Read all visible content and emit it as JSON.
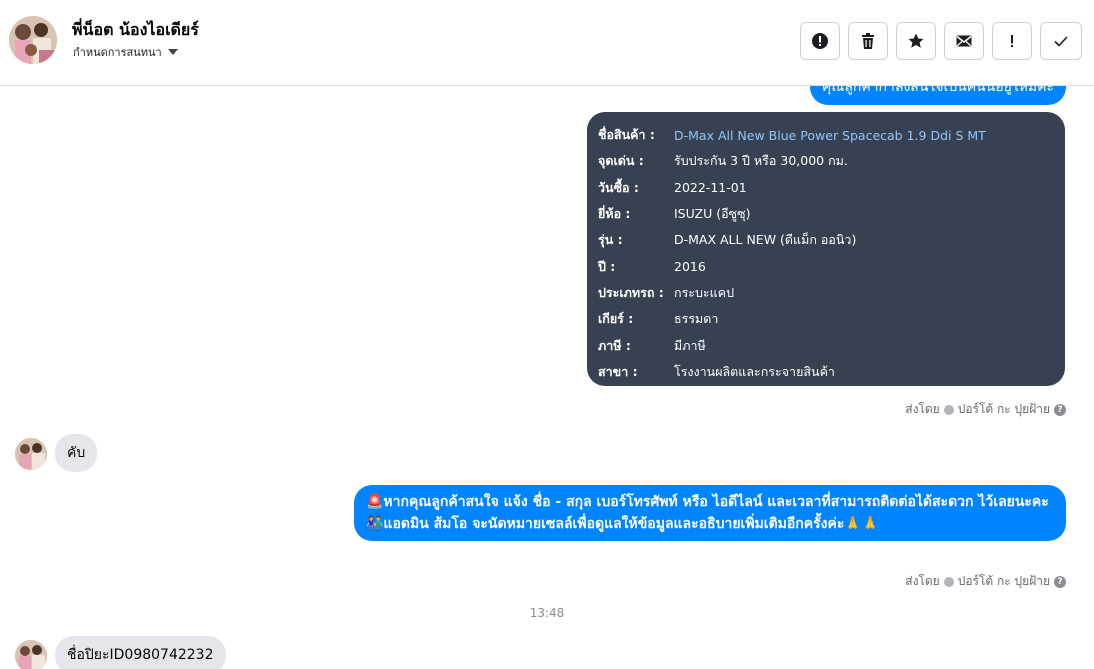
{
  "header": {
    "title": "พี่น็อต น้องไอเดียร์",
    "subtitle": "กำหนดการสนทนา"
  },
  "toolbar": {
    "buttons": [
      {
        "icon": "alert-circle-icon"
      },
      {
        "icon": "trash-icon"
      },
      {
        "icon": "star-icon"
      },
      {
        "icon": "envelope-icon"
      },
      {
        "icon": "exclamation-icon"
      },
      {
        "icon": "check-icon"
      }
    ]
  },
  "messages": {
    "top_partial": "คุณลูกค้ากำลังสนใจเป็นคันนี้อยู่ใหม่คะ",
    "card": {
      "rows": [
        {
          "label": "ชื่อสินค้า :",
          "value": "D-Max All New Blue Power Spacecab 1.9 Ddi S MT"
        },
        {
          "label": "จุดเด่น :",
          "value": "รับประกัน 3 ปี หรือ 30,000 กม."
        },
        {
          "label": "วันซื้อ :",
          "value": "2022-11-01"
        },
        {
          "label": "ยี่ห้อ :",
          "value": "ISUZU (อีซูซุ)"
        },
        {
          "label": "รุ่น :",
          "value": "D-MAX ALL NEW (ดีแม็ก ออนิว)"
        },
        {
          "label": "ปี :",
          "value": "2016"
        },
        {
          "label": "ประเภทรถ :",
          "value": "กระบะแคป"
        },
        {
          "label": "เกียร์ :",
          "value": "ธรรมดา"
        },
        {
          "label": "ภาษี :",
          "value": "มีภาษี"
        },
        {
          "label": "สาขา :",
          "value": "โรงงานผลิตและกระจายสินค้า"
        }
      ]
    },
    "sent_by_1": "ส่งโดย",
    "sender_1": "ปอร์โต้ กะ ปุยฝ้าย",
    "reply_1": "คับ",
    "long_line_1": "🚨หากคุณลูกค้าสนใจ แจ้ง ชื่อ - สกุล เบอร์โทรศัพท์ หรือ ไอดีไลน์ และเวลาที่สามารถติดต่อได้สะดวก ไว้เลยนะคะ",
    "long_line_2": "👫แอดมิน ส้มโอ จะนัดหมายเซลล์เพื่อดูแลให้ข้อมูลและอธิบายเพิ่มเติมอีกครั้งค่ะ🙏🙏",
    "sent_by_2": "ส่งโดย",
    "sender_2": "ปอร์โต้ กะ ปุยฝ้าย",
    "timestamp": "13:48",
    "reply_2": "ชื่อปิยะID0980742232"
  }
}
